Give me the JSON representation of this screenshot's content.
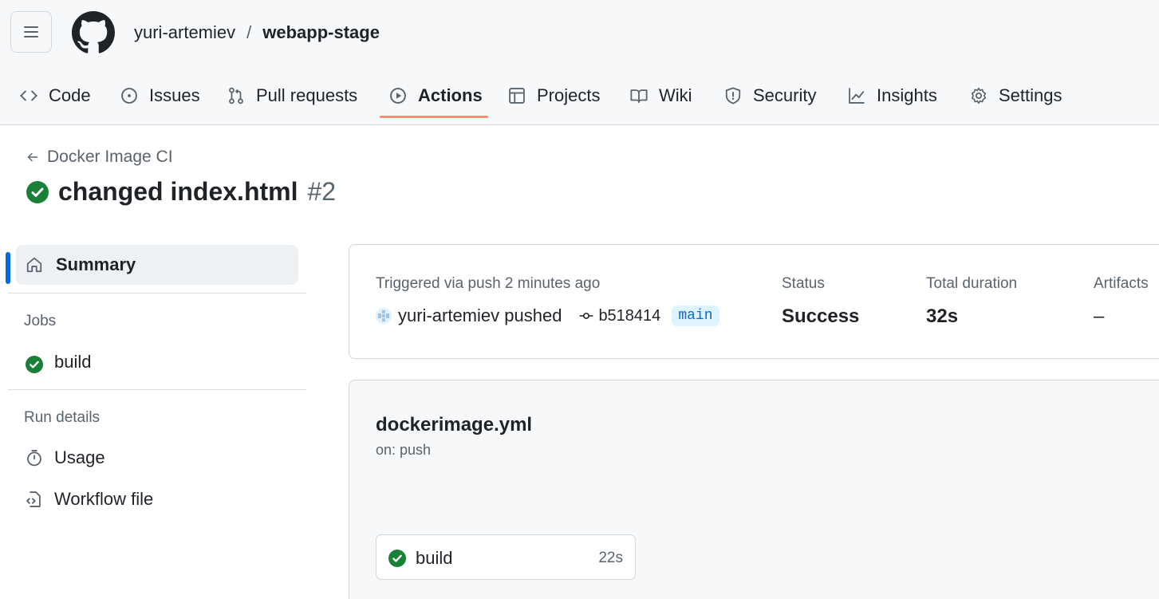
{
  "header": {
    "owner": "yuri-artemiev",
    "separator": "/",
    "repo": "webapp-stage"
  },
  "tabs": [
    {
      "label": "Code",
      "icon": "code-icon"
    },
    {
      "label": "Issues",
      "icon": "issue-opened-icon"
    },
    {
      "label": "Pull requests",
      "icon": "git-pull-request-icon"
    },
    {
      "label": "Actions",
      "icon": "play-icon",
      "active": true
    },
    {
      "label": "Projects",
      "icon": "table-icon"
    },
    {
      "label": "Wiki",
      "icon": "book-icon"
    },
    {
      "label": "Security",
      "icon": "shield-icon"
    },
    {
      "label": "Insights",
      "icon": "graph-icon"
    },
    {
      "label": "Settings",
      "icon": "gear-icon"
    }
  ],
  "run": {
    "workflow_name": "Docker Image CI",
    "title": "changed index.html",
    "number": "#2",
    "status_icon": "check-circle-fill-icon"
  },
  "sidebar": {
    "summary_label": "Summary",
    "jobs_heading": "Jobs",
    "jobs": [
      {
        "label": "build",
        "status": "success"
      }
    ],
    "run_details_heading": "Run details",
    "usage_label": "Usage",
    "workflow_file_label": "Workflow file"
  },
  "summary": {
    "triggered_label": "Triggered via push 2 minutes ago",
    "actor": "yuri-artemiev pushed",
    "commit_sha": "b518414",
    "branch": "main",
    "status_label": "Status",
    "status_value": "Success",
    "duration_label": "Total duration",
    "duration_value": "32s",
    "artifacts_label": "Artifacts",
    "artifacts_value": "–"
  },
  "workflow": {
    "file": "dockerimage.yml",
    "trigger": "on: push",
    "job": {
      "name": "build",
      "duration": "22s"
    }
  },
  "colors": {
    "accent_underline": "#fd8c73",
    "success_green": "#1a7f37",
    "link_blue": "#0969da"
  }
}
